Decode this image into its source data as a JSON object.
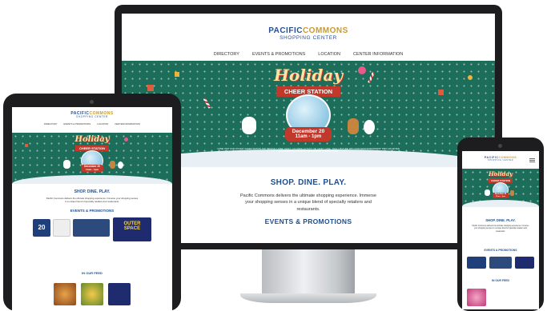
{
  "site": {
    "logo_line1_a": "PACIFIC",
    "logo_line1_b": "COMMONS",
    "logo_line2": "SHOPPING CENTER"
  },
  "nav": {
    "items": [
      "DIRECTORY",
      "EVENTS & PROMOTIONS",
      "LOCATION",
      "CENTER INFORMATION"
    ]
  },
  "hero": {
    "title": "Holiday",
    "banner": "CHEER STATION",
    "date": "December 20",
    "time": "11am - 1pm",
    "fine_print": "COME VISIT OUR HOLIDAY CHEER STATION AND RECEIVE A FREE CRAFT, COLORING ACTIVITY OR CANDY CANE. TAKE A PICTURE WITH OUR FESTIVE BACKDROP. KIDS CAN ENTER OUR COLORING CONTEST FOR A CHANCE TO WIN A PRIZE!"
  },
  "content": {
    "tagline": "SHOP. DINE. PLAY.",
    "intro": "Pacific Commons delivers the ultimate shopping experience. Immerse your shopping senses in a unique blend of specialty retailers and restaurants.",
    "events_heading": "EVENTS & PROMOTIONS",
    "feed_heading": "IN OUR FEED"
  },
  "promos": {
    "outer_space_line1": "OUTER",
    "outer_space_line2": "SPACE",
    "coupon_value": "20"
  },
  "colors": {
    "brand_blue": "#2a4f8f",
    "brand_gold": "#c99a2e",
    "hero_green": "#1c6d5a",
    "festive_red": "#c1392b",
    "device_frame": "#1d1d1f"
  }
}
